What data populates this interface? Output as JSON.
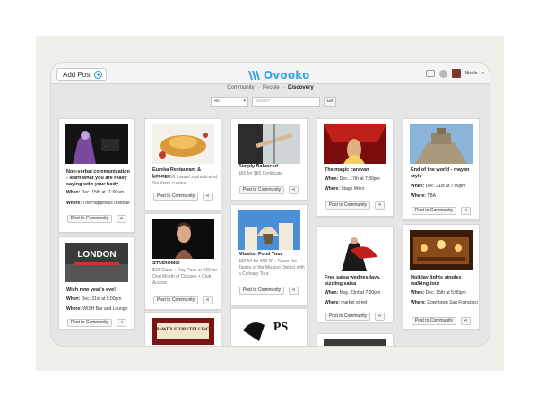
{
  "topbar": {
    "add_post_label": "Add Post",
    "logo_text": "Ovooko",
    "user_name": "Nicole"
  },
  "nav": {
    "items": [
      "Community",
      "People",
      "Discovery"
    ],
    "separator": "·",
    "active": "Discovery"
  },
  "filters": {
    "select_value": "All",
    "search_placeholder": "Search",
    "go_label": "Go"
  },
  "actions": {
    "post_label": "Post to Community",
    "share_label": "⋖"
  },
  "cards": [
    {
      "title": "Non-verbal communication - learn what you are really saying with your body",
      "when_label": "When:",
      "when": "Dec. 15th at 11:00am",
      "where_label": "Where:",
      "where": "The Happiness Institute"
    },
    {
      "title": "Eureka Restaurant & Lounge",
      "desc": "$25 for $50 toward sophisticated Southern cuisine"
    },
    {
      "title": "Simply Balanced",
      "desc": "$65 for $85 Certificate"
    },
    {
      "title": "The magic caravan",
      "when_label": "When:",
      "when": "Dec. 17th at 7:30pm",
      "where_label": "Where:",
      "where": "Stage Werx"
    },
    {
      "title": "End of the world - mayan style",
      "when_label": "When:",
      "when": "Dec. 21st at 7:00pm",
      "where_label": "Where:",
      "where": "TBA"
    },
    {
      "title": "Wish new year's eve!",
      "when_label": "When:",
      "when": "Dec. 31st at 5:00pm",
      "where_label": "Where:",
      "where": "WISH Bar and Lounge",
      "img_text": "LONDON"
    },
    {
      "title": "STUDIOMIX",
      "desc": "$10 Class + Day Pass or $69 for One Month of Classes + Club Access"
    },
    {
      "title": "Mission Food Tour",
      "desc": "$49.50 for $99.00 - Savor the Tastes of the Mission District with a Culinary Tour"
    },
    {
      "title": "Free salsa wednesdays, sizzling salsa",
      "when_label": "When:",
      "when": "May. 23rd at 7:00pm",
      "where_label": "Where:",
      "where": "market street"
    },
    {
      "title": "Holiday lights singles walking tour",
      "when_label": "When:",
      "when": "Dec. 15th at 5:00pm",
      "where_label": "Where:",
      "where": "Downtown San Francisco"
    },
    {
      "img_text": "BAWDY STORYTELLING"
    },
    {
      "img_text": "PS"
    }
  ],
  "colors": {
    "accent": "#2a8fd4",
    "logo": "#3aa3e0",
    "app_background": "#e6e6e6"
  }
}
